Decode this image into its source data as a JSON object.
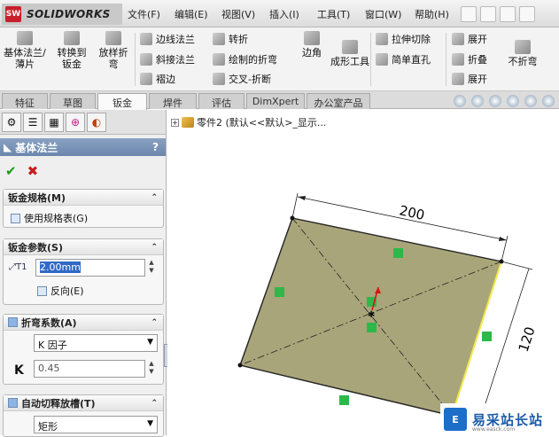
{
  "app": {
    "logo_abbr": "SW",
    "logo_text": "SOLIDWORKS"
  },
  "menu": [
    "文件(F)",
    "编辑(E)",
    "视图(V)",
    "插入(I)",
    "工具(T)",
    "窗口(W)",
    "帮助(H)"
  ],
  "ribbon": {
    "big": [
      "基体法兰/薄片",
      "转换到钣金",
      "放样折弯",
      "边角",
      "成形工具",
      "不折弯"
    ],
    "small": [
      "边线法兰",
      "斜接法兰",
      "褶边",
      "转折",
      "绘制的折弯",
      "交叉-折断",
      "拉伸切除",
      "简单直孔",
      "展开",
      "折叠",
      "展开"
    ]
  },
  "tabs": [
    "特征",
    "草图",
    "钣金",
    "焊件",
    "评估",
    "DimXpert",
    "办公室产品"
  ],
  "active_tab": "钣金",
  "panel": {
    "title": "基体法兰",
    "help": "?",
    "groups": {
      "gauge": {
        "title": "钣金规格(M)",
        "use_table": "使用规格表(G)"
      },
      "params": {
        "title": "钣金参数(S)",
        "thickness": "2.00mm",
        "reverse": "反向(E)"
      },
      "bend": {
        "title": "折弯系数(A)",
        "type": "K 因子",
        "k_label": "K",
        "k_value": "0.45"
      },
      "relief": {
        "title": "自动切释放槽(T)",
        "type": "矩形"
      }
    }
  },
  "tree": {
    "label": "零件2 (默认<<默认>_显示..."
  },
  "drawing": {
    "dim_width": "200",
    "dim_height": "120"
  },
  "watermark": {
    "text": "易采站长站",
    "url": "www.easck.com"
  }
}
